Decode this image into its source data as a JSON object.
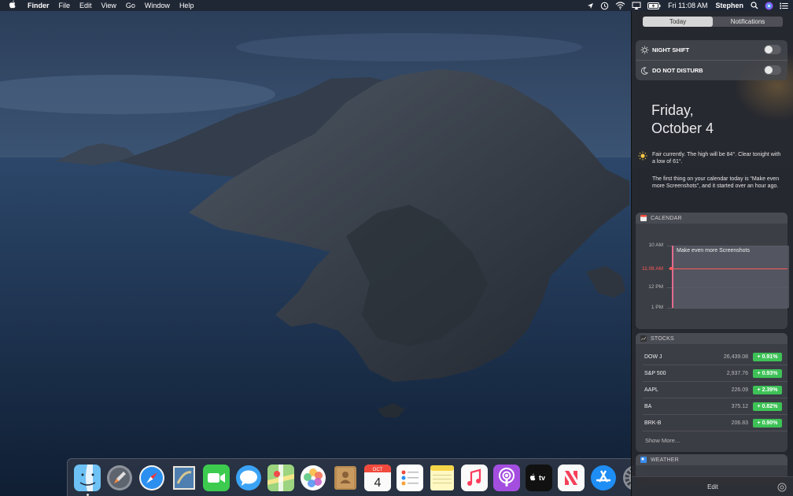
{
  "menubar": {
    "apple_icon": "apple-icon",
    "app_name": "Finder",
    "menus": [
      "File",
      "Edit",
      "View",
      "Go",
      "Window",
      "Help"
    ],
    "clock": "Fri 11:08 AM",
    "user": "Stephen",
    "status_icons": [
      "location-icon",
      "time-machine-icon",
      "wifi-icon",
      "airplay-icon",
      "battery-icon",
      "search-icon",
      "siri-icon",
      "notification-center-icon"
    ]
  },
  "notification_center": {
    "tabs": [
      "Today",
      "Notifications"
    ],
    "active_tab": "Today",
    "toggles": [
      {
        "label": "NIGHT SHIFT",
        "icon": "night-shift-icon",
        "on": false
      },
      {
        "label": "DO NOT DISTURB",
        "icon": "moon-icon",
        "on": false
      }
    ],
    "date_line1": "Friday,",
    "date_line2": "October 4",
    "weather_summary": "Fair currently. The high will be 84°. Clear tonight with a low of 61°.",
    "calendar_summary": "The first thing on your calendar today is “Make even more Screenshots”, and it started over an hour ago.",
    "calendar": {
      "title": "CALENDAR",
      "times": [
        "10 AM",
        "11:08 AM",
        "12 PM",
        "1 PM"
      ],
      "now_label": "11:08 AM",
      "event": "Make even more Screenshots"
    },
    "stocks": {
      "title": "STOCKS",
      "rows": [
        {
          "symbol": "DOW J",
          "price": "26,439.08",
          "change": "+ 0.91%"
        },
        {
          "symbol": "S&P 500",
          "price": "2,937.76",
          "change": "+ 0.93%"
        },
        {
          "symbol": "AAPL",
          "price": "226.09",
          "change": "+ 2.39%"
        },
        {
          "symbol": "BA",
          "price": "375.12",
          "change": "+ 0.82%"
        },
        {
          "symbol": "BRK-B",
          "price": "206.83",
          "change": "+ 0.90%"
        }
      ],
      "show_more": "Show More..."
    },
    "weather": {
      "title": "WEATHER"
    },
    "edit_label": "Edit"
  },
  "dock": {
    "apps": [
      "finder-icon",
      "launchpad-icon",
      "safari-icon",
      "mail-icon",
      "facetime-icon",
      "messages-icon",
      "maps-icon",
      "photos-icon",
      "contacts-icon",
      "calendar-icon",
      "reminders-icon",
      "notes-icon",
      "music-icon",
      "podcasts-icon",
      "apple-tv-icon",
      "news-icon",
      "app-store-icon",
      "system-preferences-icon"
    ],
    "calendar_icon_month": "OCT",
    "calendar_icon_day": "4",
    "tv_label": "tv"
  },
  "colors": {
    "stock_green": "#3ec257",
    "calendar_now_red": "#ff5a5a",
    "nc_background": "#26282e"
  }
}
